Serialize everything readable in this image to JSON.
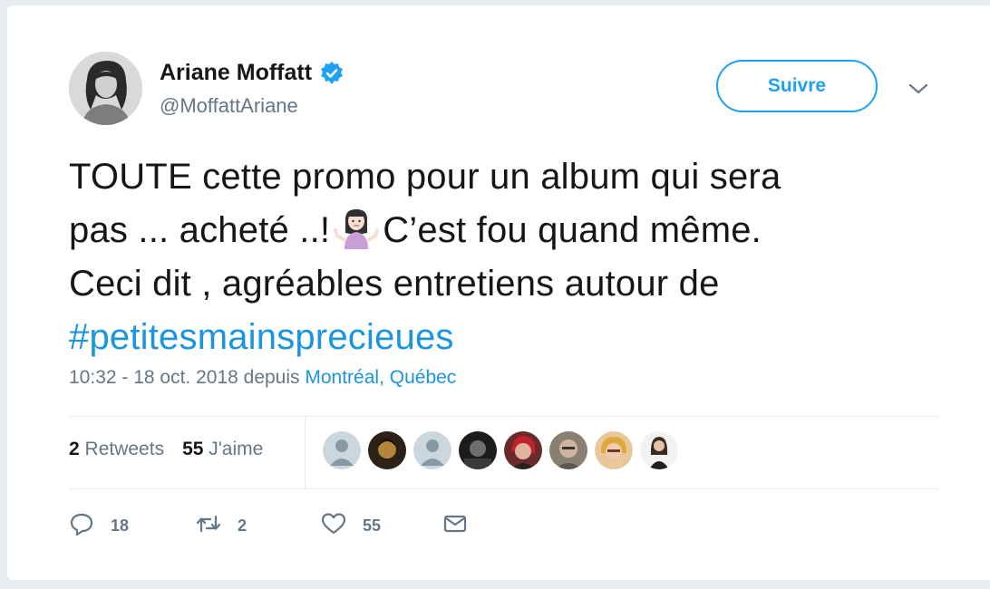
{
  "user": {
    "display_name": "Ariane Moffatt",
    "handle": "@MoffattAriane",
    "verified": true,
    "verified_icon": "verified-badge-icon"
  },
  "follow_button": {
    "label": "Suivre"
  },
  "tweet": {
    "lines": [
      "TOUTE cette promo pour un album qui sera",
      "pas ... acheté ..!",
      "C’est fou quand même.",
      "Ceci dit , agréables entretiens autour de"
    ],
    "emoji": "🤷🏻‍♀️",
    "hashtag": "#petitesmainsprecieues"
  },
  "meta": {
    "time": "10:32 - 18 oct. 2018 depuis",
    "location": "Montréal, Québec"
  },
  "stats": {
    "retweets_count": "2",
    "retweets_label": "Retweets",
    "likes_count": "55",
    "likes_label": "J'aime"
  },
  "actions": {
    "replies": "18",
    "retweets": "2",
    "likes": "55"
  },
  "colors": {
    "accent": "#1da1f2",
    "link": "#1b95e0",
    "muted": "#657786",
    "text": "#14171a",
    "background": "#e6ecf0"
  }
}
